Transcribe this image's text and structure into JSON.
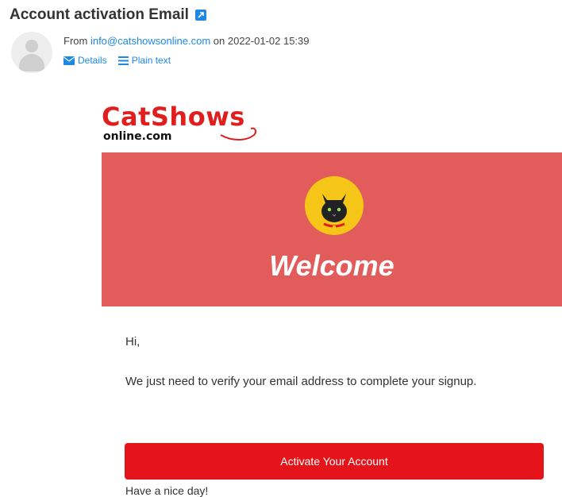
{
  "email": {
    "title": "Account activation Email",
    "from_prefix": "From ",
    "from_address": "info@catshowsonline.com",
    "date_prefix": " on ",
    "date": "2022-01-02 15:39",
    "details_label": "Details",
    "plain_text_label": "Plain text"
  },
  "body": {
    "logo_main": "CatShows",
    "logo_sub": "online.com",
    "welcome": "Welcome",
    "greeting": "Hi,",
    "message": "We just need to verify your email address to complete your signup.",
    "cta_label": "Activate Your Account",
    "closing": "Have a nice day!"
  },
  "colors": {
    "accent": "#1e88e5",
    "banner": "#e35c5c",
    "brand_red": "#e01e1e",
    "cta": "#e5141b",
    "cat_badge": "#f5c518"
  },
  "icons": {
    "edit": "external-edit-icon",
    "details": "envelope-icon",
    "plain_text": "lines-icon",
    "avatar": "user-avatar-icon",
    "cat": "cat-face-icon"
  }
}
